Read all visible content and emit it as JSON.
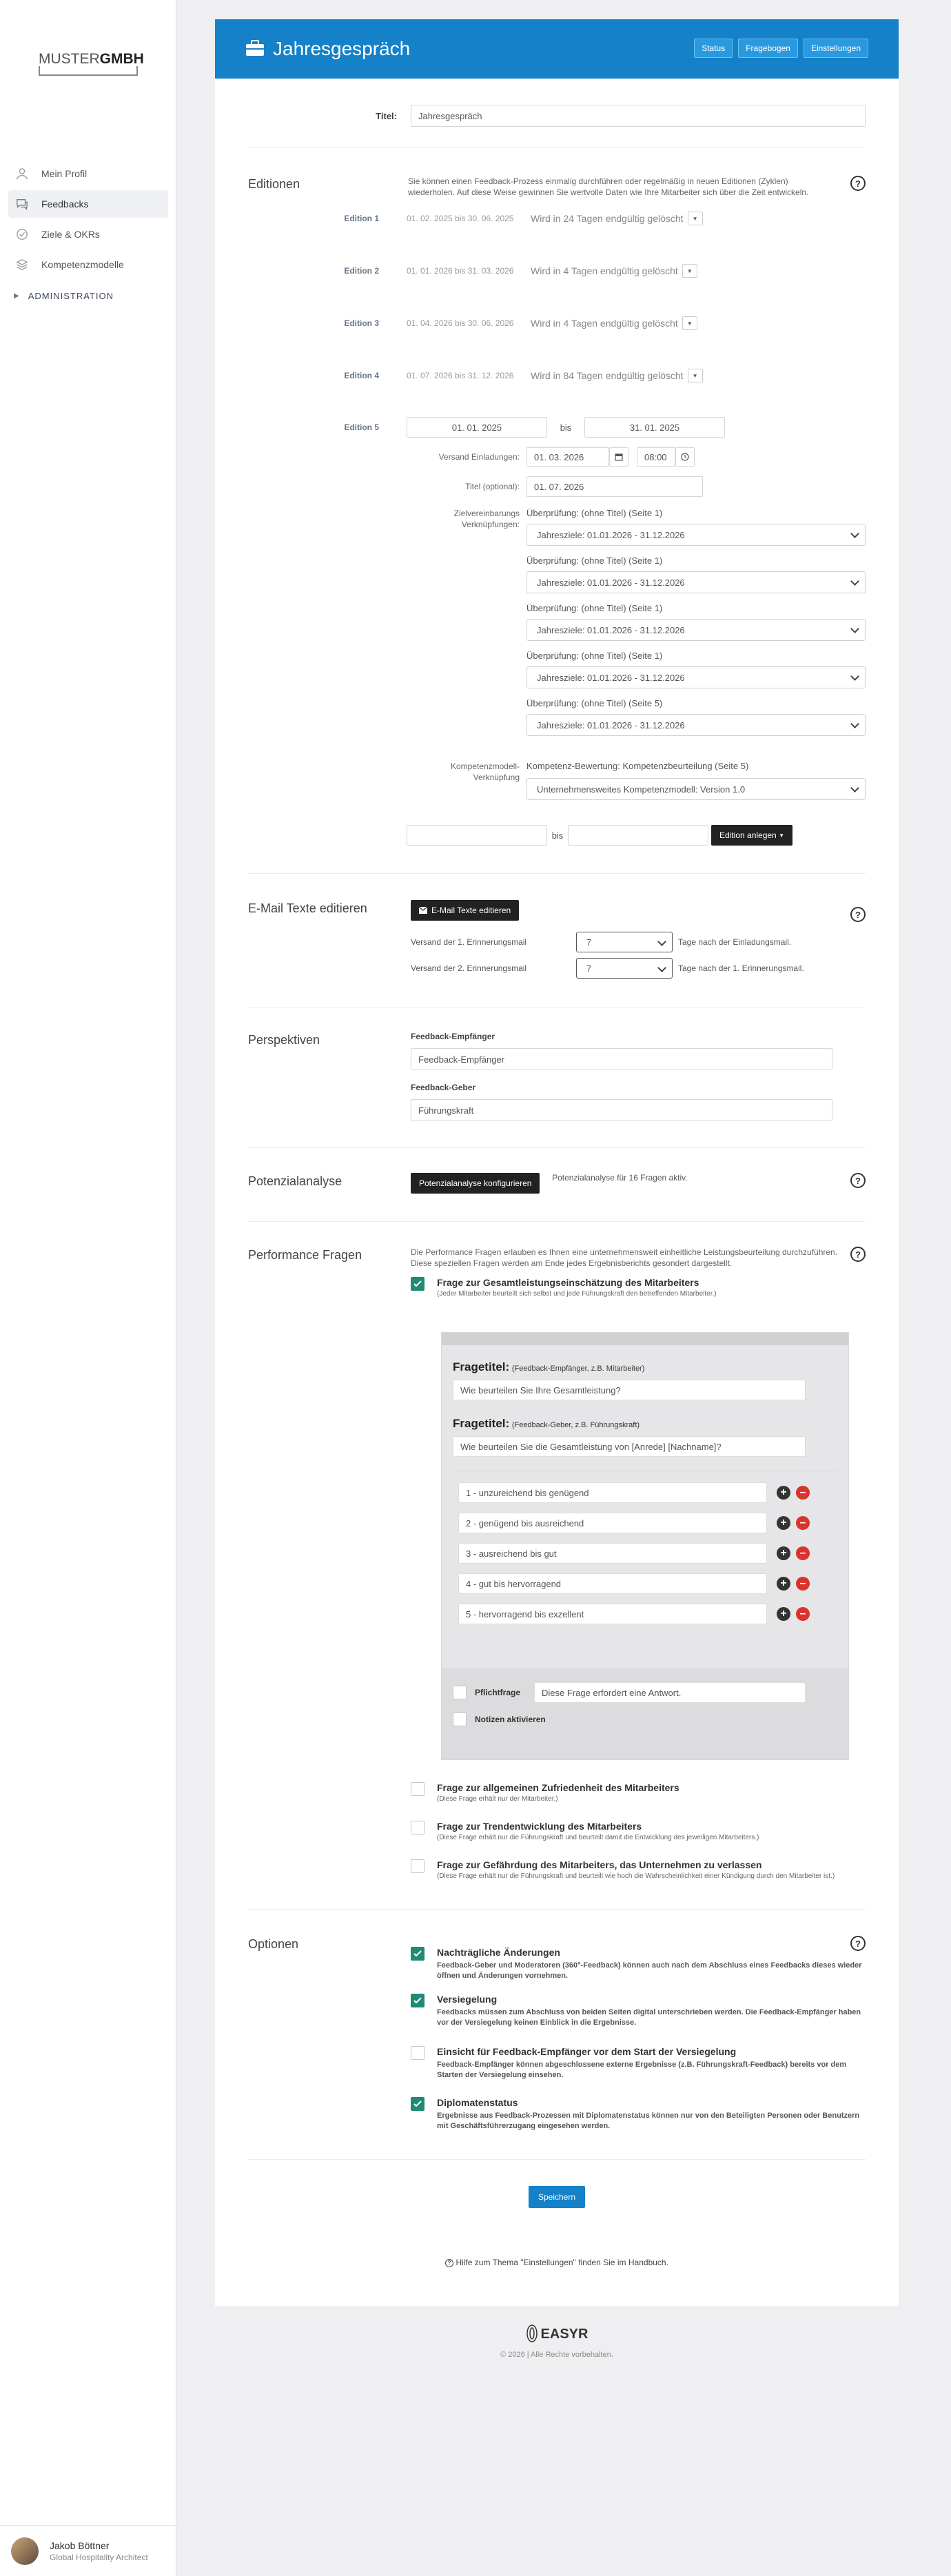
{
  "sidebar": {
    "logo": {
      "part1": "MUSTER",
      "part2": "GMBH"
    },
    "items": [
      {
        "label": "Mein Profil",
        "icon": "user-icon"
      },
      {
        "label": "Feedbacks",
        "icon": "chat-icon"
      },
      {
        "label": "Ziele & OKRs",
        "icon": "target-icon"
      },
      {
        "label": "Kompetenzmodelle",
        "icon": "layers-icon"
      }
    ],
    "section": "ADMINISTRATION",
    "user": {
      "name": "Jakob Böttner",
      "role": "Global Hospitality Architect"
    }
  },
  "header": {
    "title": "Jahresgespräch",
    "buttons": [
      "Status",
      "Fragebogen",
      "Einstellungen"
    ]
  },
  "title_field": {
    "label": "Titel:",
    "value": "Jahresgespräch"
  },
  "editionen": {
    "label": "Editionen",
    "description": "Sie können einen Feedback-Prozess einmalig durchführen oder regelmäßig in neuen Editionen (Zyklen) wiederholen. Auf diese Weise gewinnen Sie wertvolle Daten wie Ihre Mitarbeiter sich über die Zeit entwickeln.",
    "items": [
      {
        "label": "Edition 1",
        "range": "01. 02. 2025 bis 30. 06. 2025",
        "status": "Wird in 24 Tagen endgültig gelöscht"
      },
      {
        "label": "Edition 2",
        "range": "01. 01. 2026 bis 31. 03. 2026",
        "status": "Wird in 4 Tagen endgültig gelöscht"
      },
      {
        "label": "Edition 3",
        "range": "01. 04. 2026 bis 30. 06. 2026",
        "status": "Wird in 4 Tagen endgültig gelöscht"
      },
      {
        "label": "Edition 4",
        "range": "01. 07. 2026 bis 31. 12. 2026",
        "status": "Wird in 84 Tagen endgültig gelöscht"
      }
    ],
    "edition5": {
      "label": "Edition 5",
      "from": "01. 01. 2025",
      "bis": "bis",
      "to": "31. 01. 2025",
      "versand_label": "Versand Einladungen:",
      "versand_date": "01. 03. 2026",
      "versand_time": "08:00",
      "titel_label": "Titel (optional):",
      "titel_value": "01. 07. 2026",
      "ziel_label_1": "Zielvereinbarungs",
      "ziel_label_2": "Verknüpfungen:",
      "ziel_links": [
        {
          "caption": "Überprüfung: (ohne Titel) (Seite 1)",
          "value": "Jahresziele: 01.01.2026 - 31.12.2026"
        },
        {
          "caption": "Überprüfung: (ohne Titel) (Seite 1)",
          "value": "Jahresziele: 01.01.2026 - 31.12.2026"
        },
        {
          "caption": "Überprüfung: (ohne Titel) (Seite 1)",
          "value": "Jahresziele: 01.01.2026 - 31.12.2026"
        },
        {
          "caption": "Überprüfung: (ohne Titel) (Seite 1)",
          "value": "Jahresziele: 01.01.2026 - 31.12.2026"
        },
        {
          "caption": "Überprüfung: (ohne Titel) (Seite 5)",
          "value": "Jahresziele: 01.01.2026 - 31.12.2026"
        }
      ],
      "komp_label_1": "Kompetenzmodell-",
      "komp_label_2": "Verknüpfung",
      "komp_caption": "Kompetenz-Bewertung: Kompetenzbeurteilung (Seite 5)",
      "komp_value": "Unternehmensweites Kompetenzmodell: Version 1.0"
    },
    "new_bis": "bis",
    "new_button": "Edition anlegen"
  },
  "email": {
    "label": "E-Mail Texte editieren",
    "button": "E-Mail Texte editieren",
    "rows": [
      {
        "label": "Versand der 1. Erinnerungsmail",
        "value": "7",
        "suffix": "Tage nach der Einladungsmail."
      },
      {
        "label": "Versand der 2. Erinnerungsmail",
        "value": "7",
        "suffix": "Tage nach der 1. Erinnerungsmail."
      }
    ]
  },
  "perspektiven": {
    "label": "Perspektiven",
    "empfaenger_label": "Feedback-Empfänger",
    "empfaenger_value": "Feedback-Empfänger",
    "geber_label": "Feedback-Geber",
    "geber_value": "Führungskraft"
  },
  "potenzial": {
    "label": "Potenzialanalyse",
    "button": "Potenzialanalyse konfigurieren",
    "info": "Potenzialanalyse für 16 Fragen aktiv."
  },
  "performance": {
    "label": "Performance Fragen",
    "description": "Die Performance Fragen erlauben es Ihnen eine unternehmensweit einheitliche Leistungsbeurteilung durchzuführen. Diese speziellen Fragen werden am Ende jedes Ergebnisberichts gesondert dargestellt.",
    "q1": {
      "title": "Frage zur Gesamtleistungseinschätzung des Mitarbeiters",
      "desc": "(Jeder Mitarbeiter beurteilt sich selbst und jede Führungskraft den betreffenden Mitarbeiter.)"
    },
    "box": {
      "fragetitel": "Fragetitel:",
      "empf_hint": "(Feedback-Empfänger, z.B. Mitarbeiter)",
      "empf_value": "Wie beurteilen Sie Ihre Gesamtleistung?",
      "geber_hint": "(Feedback-Geber, z.B. Führungskraft)",
      "geber_value": "Wie beurteilen Sie die Gesamtleistung von [Anrede] [Nachname]?",
      "scale": [
        "1 - unzureichend bis genügend",
        "2 - genügend bis ausreichend",
        "3 - ausreichend bis gut",
        "4 - gut bis hervorragend",
        "5 - hervorragend bis exzellent"
      ],
      "pflicht_label": "Pflichtfrage",
      "pflicht_value": "Diese Frage erfordert eine Antwort.",
      "notizen_label": "Notizen aktivieren"
    },
    "others": [
      {
        "title": "Frage zur allgemeinen Zufriedenheit des Mitarbeiters",
        "desc": "(Diese Frage erhält nur der Mitarbeiter.)"
      },
      {
        "title": "Frage zur Trendentwicklung des Mitarbeiters",
        "desc": "(Diese Frage erhält nur die Führungskraft und beurteilt damit die Entwicklung des jeweiligen Mitarbeiters.)"
      },
      {
        "title": "Frage zur Gefährdung des Mitarbeiters, das Unternehmen zu verlassen",
        "desc": "(Diese Frage erhält nur die Führungskraft und beurteilt wie hoch die Wahrscheinlichkeit einer Kündigung durch den Mitarbeiter ist.)"
      }
    ]
  },
  "optionen": {
    "label": "Optionen",
    "items": [
      {
        "title": "Nachträgliche Änderungen",
        "desc": "Feedback-Geber und Moderatoren (360°-Feedback) können auch nach dem Abschluss eines Feedbacks dieses wieder öffnen und Änderungen vornehmen.",
        "checked": true
      },
      {
        "title": "Versiegelung",
        "desc": "Feedbacks müssen zum Abschluss von beiden Seiten digital unterschrieben werden. Die Feedback-Empfänger haben vor der Versiegelung keinen Einblick in die Ergebnisse.",
        "checked": true
      },
      {
        "title": "Einsicht für Feedback-Empfänger vor dem Start der Versiegelung",
        "desc": "Feedback-Empfänger können abgeschlossene externe Ergebnisse (z.B. Führungskraft-Feedback) bereits vor dem Starten der Versiegelung einsehen.",
        "checked": false
      },
      {
        "title": "Diplomatenstatus",
        "desc": "Ergebnisse aus Feedback-Prozessen mit Diplomatenstatus können nur von den Beteiligten Personen oder Benutzern mit Geschäftsführerzugang eingesehen werden.",
        "checked": true
      }
    ]
  },
  "save_label": "Speichern",
  "help_text": "Hilfe zum Thema \"Einstellungen\" finden Sie im Handbuch.",
  "footer": {
    "brand": "EASYR",
    "copyright": "© 2026 | Alle Rechte vorbehalten."
  }
}
